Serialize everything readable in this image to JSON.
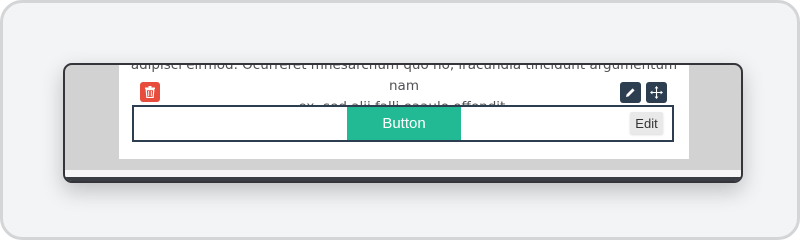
{
  "paragraph": {
    "line1": "adipisci eirmod. Ocurreret mnesarchum quo no, iracundia tincidunt argumentum nam",
    "line2": "ex, sed alii falli eaaulo offendit."
  },
  "controls": {
    "delete_icon": "trash-icon",
    "pencil_icon": "pencil-icon",
    "move_icon": "move-arrows-icon"
  },
  "button_block": {
    "button_label": "Button",
    "edit_label": "Edit"
  },
  "colors": {
    "delete": "#e74c3c",
    "toolbar": "#2c3e50",
    "accent": "#21ba94"
  }
}
